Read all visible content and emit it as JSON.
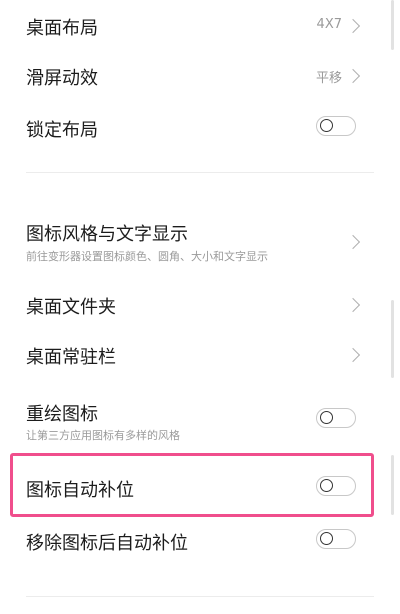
{
  "settings": {
    "desktop_layout": {
      "label": "桌面布局",
      "value": "4X7"
    },
    "scroll_effect": {
      "label": "滑屏动效",
      "value": "平移"
    },
    "lock_layout": {
      "label": "锁定布局",
      "enabled": false
    },
    "icon_style": {
      "label": "图标风格与文字显示",
      "desc": "前往变形器设置图标颜色、圆角、大小和文字显示"
    },
    "desktop_folder": {
      "label": "桌面文件夹"
    },
    "dock_bar": {
      "label": "桌面常驻栏"
    },
    "redraw_icons": {
      "label": "重绘图标",
      "desc": "让第三方应用图标有多样的风格",
      "enabled": false
    },
    "auto_fill_icons": {
      "label": "图标自动补位",
      "enabled": false
    },
    "auto_fill_after_remove": {
      "label": "移除图标后自动补位",
      "enabled": false
    }
  },
  "colors": {
    "highlight": "#f04e8c",
    "text_primary": "#1c1c1c",
    "text_secondary": "#9a9a9a"
  }
}
